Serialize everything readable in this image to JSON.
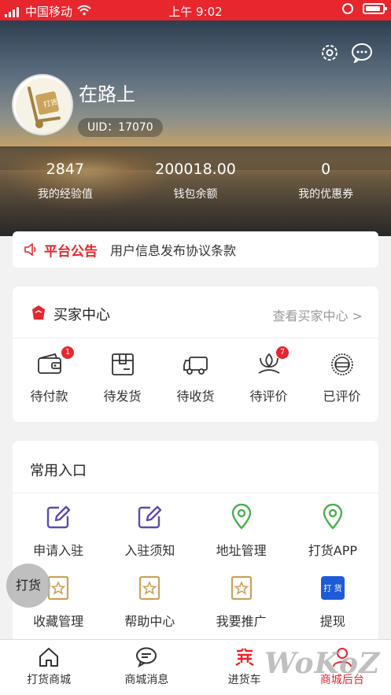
{
  "status_bar": {
    "carrier": "中国移动",
    "time": "上午 9:02"
  },
  "header": {
    "username": "在路上",
    "uid": "UID：17070",
    "avatar_text": "打货",
    "stats": [
      {
        "value": "2847",
        "label": "我的经验值"
      },
      {
        "value": "200018.00",
        "label": "钱包余额"
      },
      {
        "value": "0",
        "label": "我的优惠券"
      }
    ]
  },
  "notice": {
    "title": "平台公告",
    "text": "用户信息发布协议条款"
  },
  "buyer_center": {
    "title": "买家中心",
    "link": "查看买家中心 >",
    "orders": [
      {
        "label": "待付款",
        "icon": "wallet-icon",
        "badge": "1"
      },
      {
        "label": "待发货",
        "icon": "box-icon"
      },
      {
        "label": "待收货",
        "icon": "truck-icon"
      },
      {
        "label": "待评价",
        "icon": "flower-icon",
        "badge": "7"
      },
      {
        "label": "已评价",
        "icon": "stamp-icon"
      }
    ]
  },
  "entries": {
    "title": "常用入口",
    "items": [
      {
        "label": "申请入驻",
        "icon": "edit-icon"
      },
      {
        "label": "入驻须知",
        "icon": "edit-icon"
      },
      {
        "label": "地址管理",
        "icon": "location-icon"
      },
      {
        "label": "打货APP",
        "icon": "location-icon"
      },
      {
        "label": "收藏管理",
        "icon": "star-icon"
      },
      {
        "label": "帮助中心",
        "icon": "star-icon"
      },
      {
        "label": "我要推广",
        "icon": "star-icon"
      },
      {
        "label": "提现",
        "icon": "withdraw-icon",
        "icon_text": "打 货"
      }
    ]
  },
  "floating_button": "打货",
  "tabbar": [
    {
      "label": "打货商城",
      "icon": "home-icon"
    },
    {
      "label": "商城消息",
      "icon": "chat-icon"
    },
    {
      "label": "进货车",
      "icon": "cart-icon"
    },
    {
      "label": "商城后台",
      "icon": "user-icon"
    }
  ],
  "watermark": "WoKoZ",
  "colors": {
    "brand": "#e8262d",
    "purple": "#5b4bb5",
    "green": "#4caf50",
    "orange": "#c9a35a",
    "blue": "#1e5bd8"
  }
}
